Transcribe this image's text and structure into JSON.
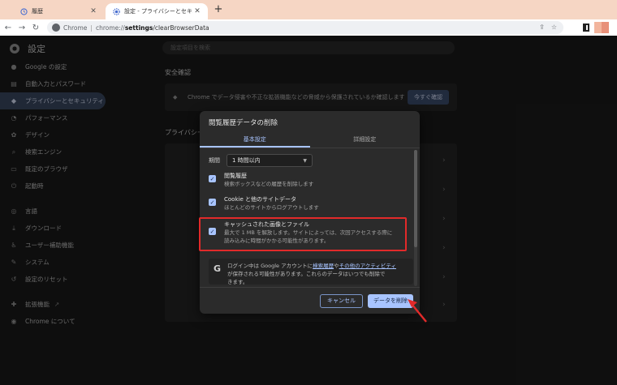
{
  "tabs": [
    {
      "label": "履歴",
      "icon": "history-icon"
    },
    {
      "label": "設定 - プライバシーとセキュリティ",
      "icon": "gear-icon"
    }
  ],
  "omnibox": {
    "host": "Chrome",
    "scheme": "chrome://",
    "path_bold": "settings",
    "path_rest": "/clearBrowserData"
  },
  "settings": {
    "title": "設定",
    "search_placeholder": "設定項目を検索",
    "sidebar": [
      {
        "label": "Google の設定",
        "icon": "person-icon"
      },
      {
        "label": "自動入力とパスワード",
        "icon": "clipboard-icon"
      },
      {
        "label": "プライバシーとセキュリティ",
        "icon": "shield-icon",
        "active": true
      },
      {
        "label": "パフォーマンス",
        "icon": "speedometer-icon"
      },
      {
        "label": "デザイン",
        "icon": "palette-icon"
      },
      {
        "label": "検索エンジン",
        "icon": "search-icon"
      },
      {
        "label": "既定のブラウザ",
        "icon": "browser-icon"
      },
      {
        "label": "起動時",
        "icon": "power-icon"
      },
      {
        "label": "言語",
        "icon": "globe-icon"
      },
      {
        "label": "ダウンロード",
        "icon": "download-icon"
      },
      {
        "label": "ユーザー補助機能",
        "icon": "accessibility-icon"
      },
      {
        "label": "システム",
        "icon": "wrench-icon"
      },
      {
        "label": "設定のリセット",
        "icon": "reset-icon"
      },
      {
        "label": "拡張機能",
        "icon": "puzzle-icon"
      },
      {
        "label": "Chrome について",
        "icon": "chrome-icon"
      }
    ],
    "safety_check": {
      "title": "安全確認",
      "text": "Chrome でデータ侵害や不正な拡張機能などの脅威から保護されているか確認します",
      "button": "今すぐ確認"
    },
    "privacy_title": "プライバシー"
  },
  "dialog": {
    "title": "閲覧履歴データの削除",
    "tab_basic": "基本設定",
    "tab_advanced": "詳細設定",
    "period_label": "期間",
    "period_value": "1 時間以内",
    "options": [
      {
        "title": "閲覧履歴",
        "desc": "検索ボックスなどの履歴を削除します",
        "checked": true
      },
      {
        "title": "Cookie と他のサイトデータ",
        "desc": "ほとんどのサイトからログアウトします",
        "checked": true
      },
      {
        "title": "キャッシュされた画像とファイル",
        "desc": "最大で 1 MB を解放します。サイトによっては、次回アクセスする際に",
        "desc2": "読み込みに時間がかかる可能性があります。",
        "checked": true
      }
    ],
    "google_notice": {
      "prefix": "ログイン中は Google アカウントに",
      "link1": "検索履歴",
      "mid": "や",
      "link2": "その他のアクティビティ",
      "suffix": "が保存される可能性があります。これらのデータはいつでも削除で",
      "suffix2": "きます。"
    },
    "cancel_label": "キャンセル",
    "delete_label": "データを削除"
  },
  "colors": {
    "accent": "#a8c4ff",
    "highlight": "#e22a2a"
  }
}
